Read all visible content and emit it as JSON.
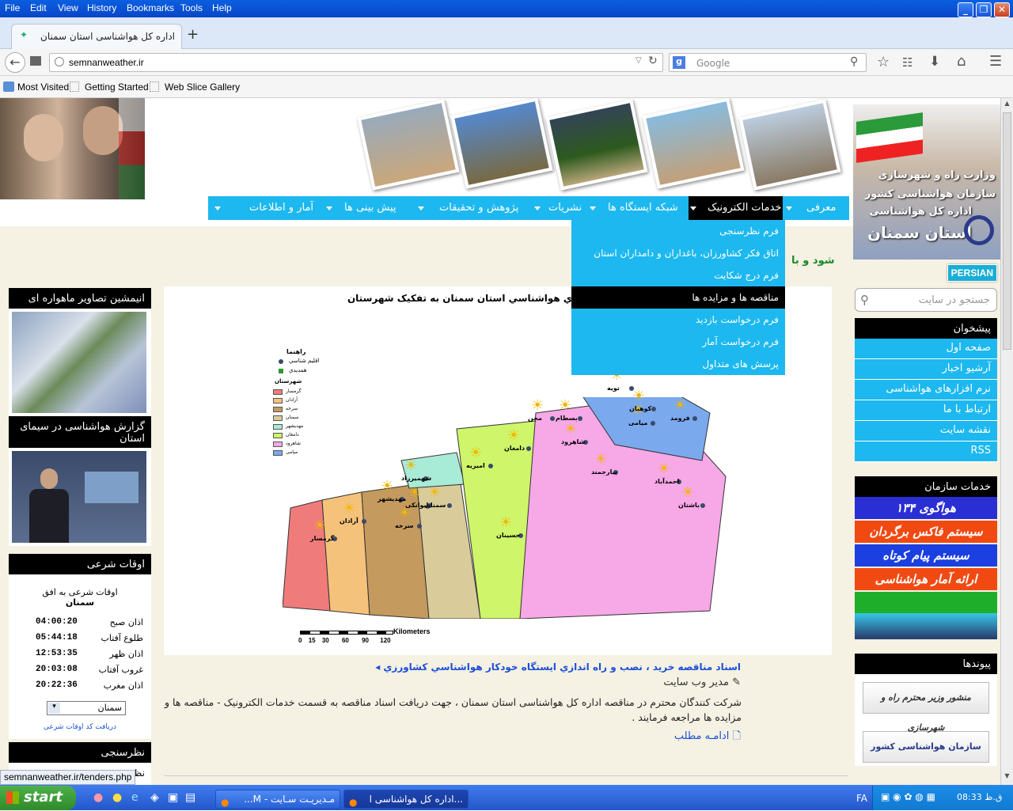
{
  "browser": {
    "menu": [
      "File",
      "Edit",
      "View",
      "History",
      "Bookmarks",
      "Tools",
      "Help"
    ],
    "tab_title": "اداره کل هواشناسی استان سمنان",
    "url": "semnanweather.ir",
    "search_placeholder": "Google",
    "bookmarks": [
      "Most Visited",
      "Getting Started",
      "Web Slice Gallery"
    ],
    "status_url": "semnanweather.ir/tenders.php"
  },
  "site": {
    "header_lines": [
      "وزارت راه و شهرسازی",
      "سازمان هواشناسی کشور",
      "اداره کل هواشناسی",
      "استان سمنان"
    ],
    "persian_label": "PERSIAN",
    "search_placeholder": "جستجو در سایت",
    "nav": [
      "معرفی",
      "خدمات الکترونیک",
      "شبکه ایستگاه ها",
      "نشریات",
      "پژوهش و تحقیقات",
      "پیش بینی ها",
      "آمار و اطلاعات"
    ],
    "dropdown": [
      "فرم نظرسنجی",
      "اتاق فکر کشاورزان، باغداران و دامداران استان",
      "فرم درج شکایت",
      "مناقصه ها و مزایده ها",
      "فرم درخواست بازدید",
      "فرم درخواست آمار",
      "پرسش های متداول"
    ],
    "marquee_text": "شود و با",
    "map_title": "اي هواشناسي استان سمنان به تفکيک شهرستان",
    "map_legend_title": "راهنما",
    "map_legend_items": [
      "اقليم شناسي",
      "همديدي"
    ],
    "map_legend_subtitle": "شهرستان",
    "map_counties": [
      "گرمسار",
      "آرادان",
      "سرخه",
      "سمنان",
      "مهدیشهر",
      "دامغان",
      "شاهرود",
      "میامی"
    ],
    "map_cities": [
      "گرمسار",
      "آرادان",
      "سرخه",
      "ایوانکی",
      "مهدیشهر",
      "سمنان",
      "شهمیرزاد",
      "دامغان",
      "امیریه",
      "حسینان",
      "شاهرود",
      "بسطام",
      "میامی",
      "کوهبان",
      "فرومد",
      "بیارجمند",
      "احمدآباد",
      "باشتان",
      "مجن",
      "تویه"
    ],
    "map_scale_label": "Kilometers",
    "map_scale_ticks": [
      "0",
      "15",
      "30",
      "60",
      "90",
      "120"
    ],
    "news_title": "اسناد مناقصه خريد ، نصب و راه اندازي ايستگاه خودکار هواشناسي کشاورزي",
    "news_author": "مدیر وب سایت",
    "news_body": "شرکت کنندگان محترم در مناقصه اداره کل هواشناسی استان سمنان ، جهت دریافت اسناد مناقصه به قسمت خدمات الکترونیک - مناقصه ها و مزایده ها مراجعه فرمایند .",
    "read_more": "ادامـه مطلب",
    "left_boxes": {
      "sat_title": "انیمشین تصاویر ماهواره ای",
      "tv_title": "گزارش هواشناسی در سیمای استان",
      "prayer_title": "اوقات شرعی",
      "prayer_sub1": "اوقات شرعی به افق",
      "prayer_sub2": "سمنان",
      "prayer_rows": [
        {
          "label": "اذان صبح",
          "time": "04:00:20"
        },
        {
          "label": "طلوع آفتاب",
          "time": "05:44:18"
        },
        {
          "label": "اذان ظهر",
          "time": "12:53:35"
        },
        {
          "label": "غروب آفتاب",
          "time": "20:03:08"
        },
        {
          "label": "اذان مغرب",
          "time": "20:22:36"
        }
      ],
      "city_select": "سمنان",
      "code_link": "دریافت کد اوقات شرعی",
      "poll_title": "نظرسنجی",
      "poll_text": "نظر ش"
    },
    "right_menu_title": "پیشخوان",
    "right_menu": [
      "صفحه اول",
      "آرشیو اخبار",
      "نرم افزارهای هواشناسی",
      "ارتباط با ما",
      "نقشه سایت",
      "RSS"
    ],
    "services_title": "خدمات سازمان",
    "services": [
      {
        "label": "هواگوی ۱۳۴",
        "color": "#2a2fd4"
      },
      {
        "label": "سیستم فاکس برگردان",
        "color": "#f04a12"
      },
      {
        "label": "سیستم پیام کوتاه",
        "color": "#1b3fe0"
      },
      {
        "label": "ارائه آمار هواشناسی",
        "color": "#f04a12"
      }
    ],
    "links_title": "پیوندها",
    "link_banners": [
      "منشور وزیر محترم راه و شهرسازی",
      "سازمان هواشناسی کشور"
    ]
  },
  "taskbar": {
    "start": "start",
    "items": [
      "مـدیریـت سـایت - M...",
      "...اداره کل هواشناسی ا"
    ],
    "lang": "FA",
    "clock": "ق.ظ 08:33"
  },
  "colors": {
    "accent": "#1db8ef",
    "page_bg": "#f5f1e3"
  }
}
